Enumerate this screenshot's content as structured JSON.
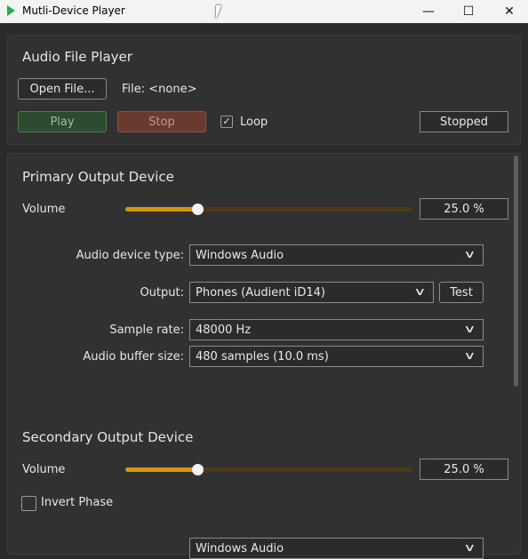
{
  "window": {
    "title": "Mutli-Device Player",
    "icon": "app-play-icon",
    "buttons": [
      "minimize-icon",
      "maximize-icon",
      "close-icon"
    ]
  },
  "file_player": {
    "title": "Audio File Player",
    "open_button": "Open File...",
    "file_label": "File: <none>",
    "play_button": "Play",
    "stop_button": "Stop",
    "loop_label": "Loop",
    "loop_checked": true,
    "status": "Stopped",
    "colors": {
      "play": "#2c4c2f",
      "stop": "#6a3a2f"
    }
  },
  "primary": {
    "title": "Primary Output Device",
    "volume_label": "Volume",
    "volume_value": "25.0 %",
    "volume_fraction": 0.25,
    "device_type_label": "Audio device type:",
    "device_type_value": "Windows Audio",
    "output_label": "Output:",
    "output_value": "Phones (Audient iD14)",
    "test_button": "Test",
    "sample_rate_label": "Sample rate:",
    "sample_rate_value": "48000 Hz",
    "buffer_label": "Audio buffer size:",
    "buffer_value": "480 samples (10.0 ms)"
  },
  "secondary": {
    "title": "Secondary Output Device",
    "volume_label": "Volume",
    "volume_value": "25.0 %",
    "volume_fraction": 0.25,
    "invert_label": "Invert Phase",
    "invert_checked": false,
    "device_type_value": "Windows Audio"
  },
  "accent_color": "#d8940f"
}
